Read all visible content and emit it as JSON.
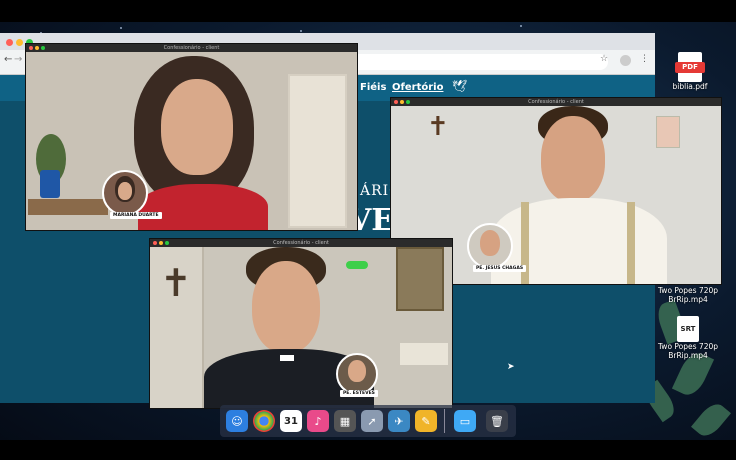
{
  "browser": {
    "url": "",
    "nav_links": [
      "Fiéis",
      "Ofertório"
    ],
    "banner_line1": "ÁRIO",
    "banner_line2": "VE"
  },
  "windows": [
    {
      "title": "Confessionário - client",
      "tag": "MARIANA DUARTE"
    },
    {
      "title": "Confessionário - client",
      "tag": "PE. JESUS CHAGAS"
    },
    {
      "title": "Confessionário - client",
      "tag": "PE. ESTEVES"
    }
  ],
  "desktop_files": [
    {
      "label": "biblia.pdf",
      "badge": "PDF"
    },
    {
      "label": "Two Popes 720p BrRip.mp4",
      "badge": ""
    },
    {
      "label": "Two Popes 720p BrRip.mp4",
      "badge": "SRT"
    }
  ],
  "dock": {
    "calendar_day": "31",
    "items": [
      "finder-icon",
      "chrome-icon",
      "calendar-icon",
      "itunes-icon",
      "photo-icon",
      "rocket-icon",
      "bird-icon",
      "pencil-icon",
      "folder-icon",
      "trash-icon"
    ]
  },
  "colors": {
    "site_blue": "#0f6285",
    "pdf_red": "#e53935"
  }
}
